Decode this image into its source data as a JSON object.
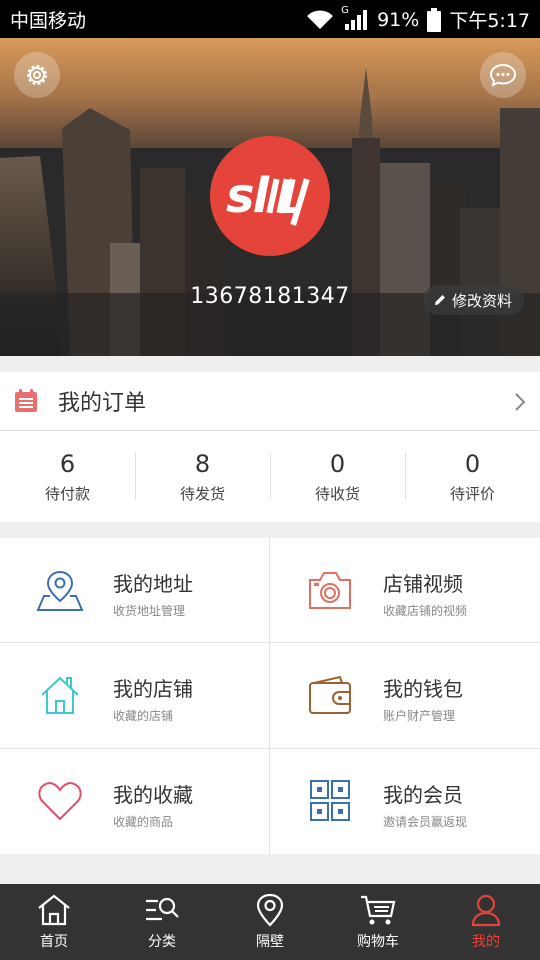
{
  "status_bar": {
    "carrier": "中国移动",
    "network": "G",
    "battery": "91%",
    "time": "下午5:17"
  },
  "profile": {
    "avatar_logo": "slhy",
    "phone": "13678181347",
    "edit_label": "修改资料"
  },
  "orders": {
    "title": "我的订单",
    "stats": [
      {
        "count": "6",
        "label": "待付款"
      },
      {
        "count": "8",
        "label": "待发货"
      },
      {
        "count": "0",
        "label": "待收货"
      },
      {
        "count": "0",
        "label": "待评价"
      }
    ]
  },
  "menu": [
    {
      "title": "我的地址",
      "subtitle": "收货地址管理",
      "icon": "map-pin-icon",
      "color": "#3a6fb4"
    },
    {
      "title": "店铺视频",
      "subtitle": "收藏店铺的视频",
      "icon": "camera-icon",
      "color": "#e07060"
    },
    {
      "title": "我的店铺",
      "subtitle": "收藏的店铺",
      "icon": "house-icon",
      "color": "#3cc8cf"
    },
    {
      "title": "我的钱包",
      "subtitle": "账户财产管理",
      "icon": "wallet-icon",
      "color": "#9a6232"
    },
    {
      "title": "我的收藏",
      "subtitle": "收藏的商品",
      "icon": "heart-icon",
      "color": "#e0506a"
    },
    {
      "title": "我的会员",
      "subtitle": "邀请会员赢返现",
      "icon": "grid-icon",
      "color": "#3a6fb4"
    }
  ],
  "tabbar": {
    "items": [
      {
        "label": "首页",
        "icon": "home-icon"
      },
      {
        "label": "分类",
        "icon": "category-search-icon"
      },
      {
        "label": "隔壁",
        "icon": "location-pin-icon"
      },
      {
        "label": "购物车",
        "icon": "cart-icon"
      },
      {
        "label": "我的",
        "icon": "user-icon"
      }
    ],
    "active_index": 4
  },
  "colors": {
    "accent": "#e5443a",
    "tabbar_bg": "#333333",
    "page_bg": "#efeff0"
  }
}
